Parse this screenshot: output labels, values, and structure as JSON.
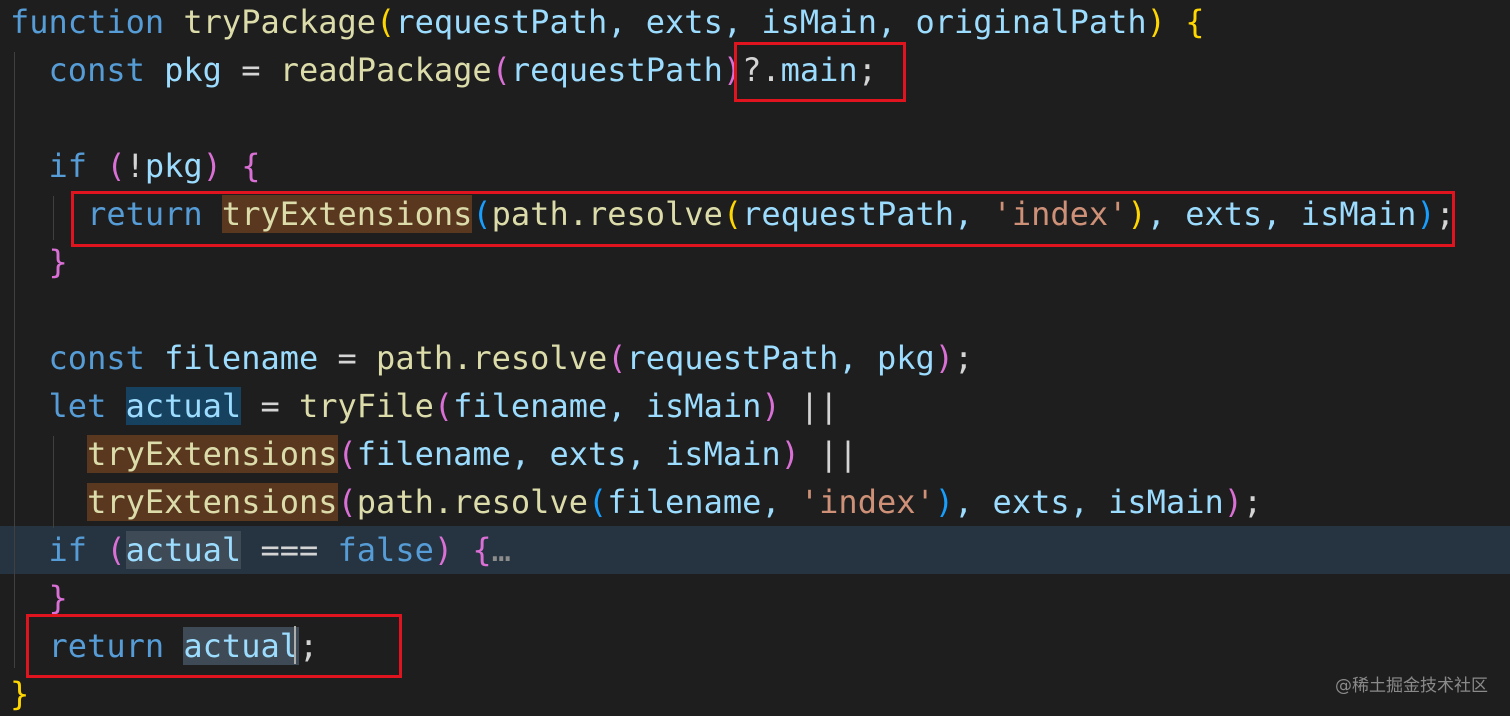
{
  "colors": {
    "background": "#1e1e1e",
    "keyword": "#569cd6",
    "function": "#dcdcaa",
    "variable": "#9cdcfe",
    "string": "#ce9178",
    "bracket_level1": "#ffd700",
    "bracket_level2": "#da70d6",
    "bracket_level3": "#179fff",
    "annotation_box": "#e0141e"
  },
  "code": {
    "lines": [
      {
        "tokens": [
          {
            "t": "function",
            "c": "kw"
          },
          {
            "t": " ",
            "c": "plain"
          },
          {
            "t": "tryPackage",
            "c": "fn"
          },
          {
            "t": "(",
            "c": "b1"
          },
          {
            "t": "requestPath, exts, isMain, originalPath",
            "c": "var"
          },
          {
            "t": ")",
            "c": "b1"
          },
          {
            "t": " ",
            "c": "plain"
          },
          {
            "t": "{",
            "c": "b1"
          }
        ]
      },
      {
        "tokens": [
          {
            "t": "  ",
            "c": "plain"
          },
          {
            "t": "const",
            "c": "kw"
          },
          {
            "t": " ",
            "c": "plain"
          },
          {
            "t": "pkg",
            "c": "var"
          },
          {
            "t": " = ",
            "c": "plain"
          },
          {
            "t": "readPackage",
            "c": "fn"
          },
          {
            "t": "(",
            "c": "b2"
          },
          {
            "t": "requestPath",
            "c": "var"
          },
          {
            "t": ")",
            "c": "b2"
          },
          {
            "t": "?.",
            "c": "plain"
          },
          {
            "t": "main",
            "c": "var"
          },
          {
            "t": ";",
            "c": "plain"
          }
        ]
      },
      {
        "tokens": []
      },
      {
        "tokens": [
          {
            "t": "  ",
            "c": "plain"
          },
          {
            "t": "if",
            "c": "kw"
          },
          {
            "t": " ",
            "c": "plain"
          },
          {
            "t": "(",
            "c": "b2"
          },
          {
            "t": "!",
            "c": "plain"
          },
          {
            "t": "pkg",
            "c": "var"
          },
          {
            "t": ")",
            "c": "b2"
          },
          {
            "t": " ",
            "c": "plain"
          },
          {
            "t": "{",
            "c": "b2"
          }
        ]
      },
      {
        "tokens": [
          {
            "t": "    ",
            "c": "plain"
          },
          {
            "t": "return",
            "c": "kw"
          },
          {
            "t": " ",
            "c": "plain"
          },
          {
            "t": "tryExtensions",
            "c": "fn",
            "h": "fn"
          },
          {
            "t": "(",
            "c": "b3"
          },
          {
            "t": "path.resolve",
            "c": "fn"
          },
          {
            "t": "(",
            "c": "b1"
          },
          {
            "t": "requestPath, ",
            "c": "var"
          },
          {
            "t": "'index'",
            "c": "str"
          },
          {
            "t": ")",
            "c": "b1"
          },
          {
            "t": ", exts, isMain",
            "c": "var"
          },
          {
            "t": ")",
            "c": "b3"
          },
          {
            "t": ";",
            "c": "plain"
          }
        ]
      },
      {
        "tokens": [
          {
            "t": "  ",
            "c": "plain"
          },
          {
            "t": "}",
            "c": "b2"
          }
        ]
      },
      {
        "tokens": []
      },
      {
        "tokens": [
          {
            "t": "  ",
            "c": "plain"
          },
          {
            "t": "const",
            "c": "kw"
          },
          {
            "t": " ",
            "c": "plain"
          },
          {
            "t": "filename",
            "c": "var"
          },
          {
            "t": " = ",
            "c": "plain"
          },
          {
            "t": "path.resolve",
            "c": "fn"
          },
          {
            "t": "(",
            "c": "b2"
          },
          {
            "t": "requestPath, pkg",
            "c": "var"
          },
          {
            "t": ")",
            "c": "b2"
          },
          {
            "t": ";",
            "c": "plain"
          }
        ]
      },
      {
        "tokens": [
          {
            "t": "  ",
            "c": "plain"
          },
          {
            "t": "let",
            "c": "kw"
          },
          {
            "t": " ",
            "c": "plain"
          },
          {
            "t": "actual",
            "c": "var",
            "h": "ref"
          },
          {
            "t": " = ",
            "c": "plain"
          },
          {
            "t": "tryFile",
            "c": "fn"
          },
          {
            "t": "(",
            "c": "b2"
          },
          {
            "t": "filename, isMain",
            "c": "var"
          },
          {
            "t": ")",
            "c": "b2"
          },
          {
            "t": " ||",
            "c": "plain"
          }
        ]
      },
      {
        "tokens": [
          {
            "t": "    ",
            "c": "plain"
          },
          {
            "t": "tryExtensions",
            "c": "fn",
            "h": "fn"
          },
          {
            "t": "(",
            "c": "b2"
          },
          {
            "t": "filename, exts, isMain",
            "c": "var"
          },
          {
            "t": ")",
            "c": "b2"
          },
          {
            "t": " ||",
            "c": "plain"
          }
        ]
      },
      {
        "tokens": [
          {
            "t": "    ",
            "c": "plain"
          },
          {
            "t": "tryExtensions",
            "c": "fn",
            "h": "fn"
          },
          {
            "t": "(",
            "c": "b2"
          },
          {
            "t": "path.resolve",
            "c": "fn"
          },
          {
            "t": "(",
            "c": "b3"
          },
          {
            "t": "filename, ",
            "c": "var"
          },
          {
            "t": "'index'",
            "c": "str"
          },
          {
            "t": ")",
            "c": "b3"
          },
          {
            "t": ", exts, isMain",
            "c": "var"
          },
          {
            "t": ")",
            "c": "b2"
          },
          {
            "t": ";",
            "c": "plain"
          }
        ]
      },
      {
        "current": true,
        "tokens": [
          {
            "t": "  ",
            "c": "plain"
          },
          {
            "t": "if",
            "c": "kw"
          },
          {
            "t": " ",
            "c": "plain"
          },
          {
            "t": "(",
            "c": "b2"
          },
          {
            "t": "actual",
            "c": "var",
            "h": "sel"
          },
          {
            "t": " === ",
            "c": "plain"
          },
          {
            "t": "false",
            "c": "kw"
          },
          {
            "t": ")",
            "c": "b2"
          },
          {
            "t": " ",
            "c": "plain"
          },
          {
            "t": "{",
            "c": "b2"
          },
          {
            "t": "…",
            "c": "fold"
          }
        ]
      },
      {
        "tokens": [
          {
            "t": "  ",
            "c": "plain"
          },
          {
            "t": "}",
            "c": "b2"
          }
        ]
      },
      {
        "tokens": [
          {
            "t": "  ",
            "c": "plain"
          },
          {
            "t": "return",
            "c": "kw"
          },
          {
            "t": " ",
            "c": "plain"
          },
          {
            "t": "actual",
            "c": "var",
            "h": "sel"
          },
          {
            "t": ";",
            "c": "plain"
          }
        ]
      },
      {
        "tokens": [
          {
            "t": "}",
            "c": "b1"
          }
        ]
      }
    ]
  },
  "watermark": "@稀土掘金技术社区"
}
